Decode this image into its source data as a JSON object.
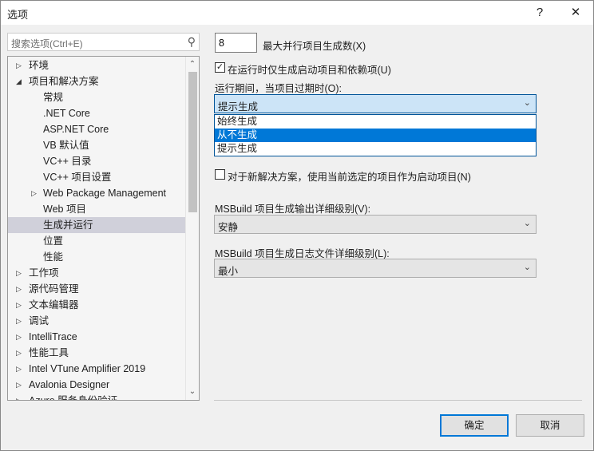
{
  "window": {
    "title": "选项",
    "help": "?",
    "close": "✕"
  },
  "search": {
    "placeholder": "搜索选项(Ctrl+E)",
    "icon": "search-icon"
  },
  "tree": [
    {
      "label": "环境",
      "level": 0,
      "expander": "collapsed"
    },
    {
      "label": "项目和解决方案",
      "level": 0,
      "expander": "expanded"
    },
    {
      "label": "常规",
      "level": 1
    },
    {
      "label": ".NET Core",
      "level": 1
    },
    {
      "label": "ASP.NET Core",
      "level": 1
    },
    {
      "label": "VB 默认值",
      "level": 1
    },
    {
      "label": "VC++ 目录",
      "level": 1
    },
    {
      "label": "VC++ 项目设置",
      "level": 1
    },
    {
      "label": "Web Package Management",
      "level": 1,
      "expander": "collapsed"
    },
    {
      "label": "Web 项目",
      "level": 1
    },
    {
      "label": "生成并运行",
      "level": 1,
      "selected": true
    },
    {
      "label": "位置",
      "level": 1
    },
    {
      "label": "性能",
      "level": 1
    },
    {
      "label": "工作项",
      "level": 0,
      "expander": "collapsed"
    },
    {
      "label": "源代码管理",
      "level": 0,
      "expander": "collapsed"
    },
    {
      "label": "文本编辑器",
      "level": 0,
      "expander": "collapsed"
    },
    {
      "label": "调试",
      "level": 0,
      "expander": "collapsed"
    },
    {
      "label": "IntelliTrace",
      "level": 0,
      "expander": "collapsed"
    },
    {
      "label": "性能工具",
      "level": 0,
      "expander": "collapsed"
    },
    {
      "label": "Intel VTune Amplifier 2019",
      "level": 0,
      "expander": "collapsed"
    },
    {
      "label": "Avalonia Designer",
      "level": 0,
      "expander": "collapsed"
    },
    {
      "label": "Azure 服务身份验证",
      "level": 0,
      "expander": "collapsed"
    }
  ],
  "settings": {
    "max_parallel": {
      "value": "8",
      "label": "最大并行项目生成数(X)"
    },
    "only_startup": {
      "checked": true,
      "label": "在运行时仅生成启动项目和依赖项(U)"
    },
    "out_of_date": {
      "label": "运行期间，当项目过期时(O):",
      "value": "提示生成",
      "options": [
        "始终生成",
        "从不生成",
        "提示生成"
      ],
      "highlighted": "从不生成"
    },
    "new_solution": {
      "checked": false,
      "label": "对于新解决方案，使用当前选定的项目作为启动项目(N)"
    },
    "output_verbosity": {
      "label": "MSBuild 项目生成输出详细级别(V):",
      "value": "安静"
    },
    "log_verbosity": {
      "label": "MSBuild 项目生成日志文件详细级别(L):",
      "value": "最小"
    }
  },
  "buttons": {
    "ok": "确定",
    "cancel": "取消"
  }
}
